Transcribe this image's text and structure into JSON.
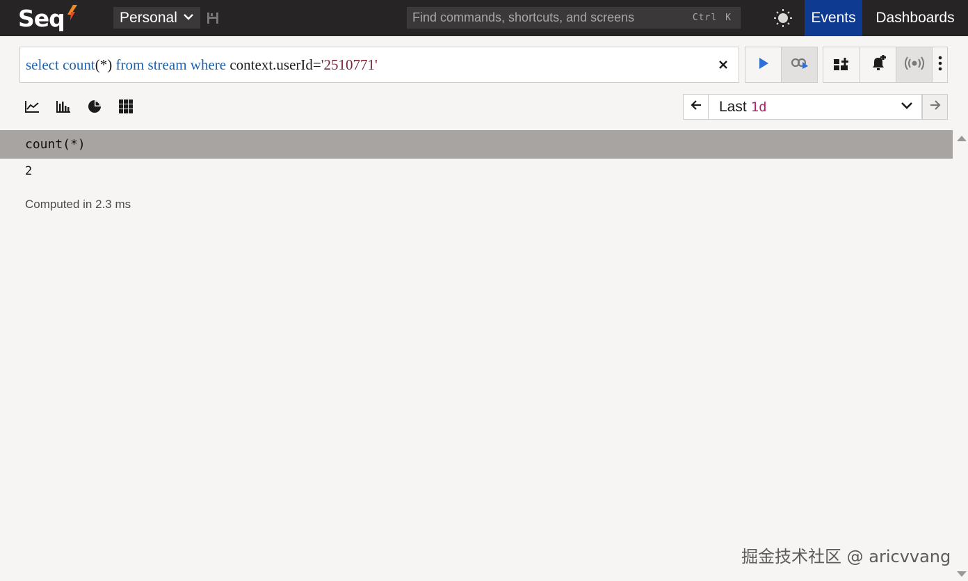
{
  "app": {
    "logo": "Seq"
  },
  "topbar": {
    "workspace": "Personal",
    "command_placeholder": "Find commands, shortcuts, and screens",
    "shortcut_key1": "Ctrl",
    "shortcut_key2": "K",
    "nav": {
      "events": "Events",
      "dashboards": "Dashboards"
    }
  },
  "query": {
    "tokens": {
      "t1": "select",
      "t2": " ",
      "t3": "count",
      "t4": "(*) ",
      "t5": "from",
      "t6": " ",
      "t7": "stream",
      "t8": " ",
      "t9": "where",
      "t10": " context.userId=",
      "t11": "'2510771'"
    }
  },
  "time_range": {
    "prefix": "Last",
    "value": "1d"
  },
  "result": {
    "column": "count(*)",
    "value": "2",
    "computed": "Computed in 2.3 ms"
  },
  "watermark": "掘金技术社区 @ aricvvang",
  "colors": {
    "topbar": "#262424",
    "active_nav": "#0e3b91",
    "keyword": "#1a63b2",
    "string": "#7a2438",
    "range_value": "#b3216b",
    "run_icon": "#2e6fd6"
  },
  "icons": {
    "logo": "seq-logo-icon",
    "workspace": "chevron-down-icon",
    "save": "save-icon",
    "theme": "sun-icon",
    "clear": "close-icon",
    "run": "play-icon",
    "refresh": "refresh-icon",
    "add_signal": "add-grid-icon",
    "add_alert": "bell-add-icon",
    "broadcast": "broadcast-icon",
    "more": "more-vertical-icon",
    "viz_line": "line-chart-icon",
    "viz_bar": "bar-chart-icon",
    "viz_pie": "pie-chart-icon",
    "viz_grid": "grid-icon",
    "prev": "arrow-left-icon",
    "next": "arrow-right-icon"
  }
}
